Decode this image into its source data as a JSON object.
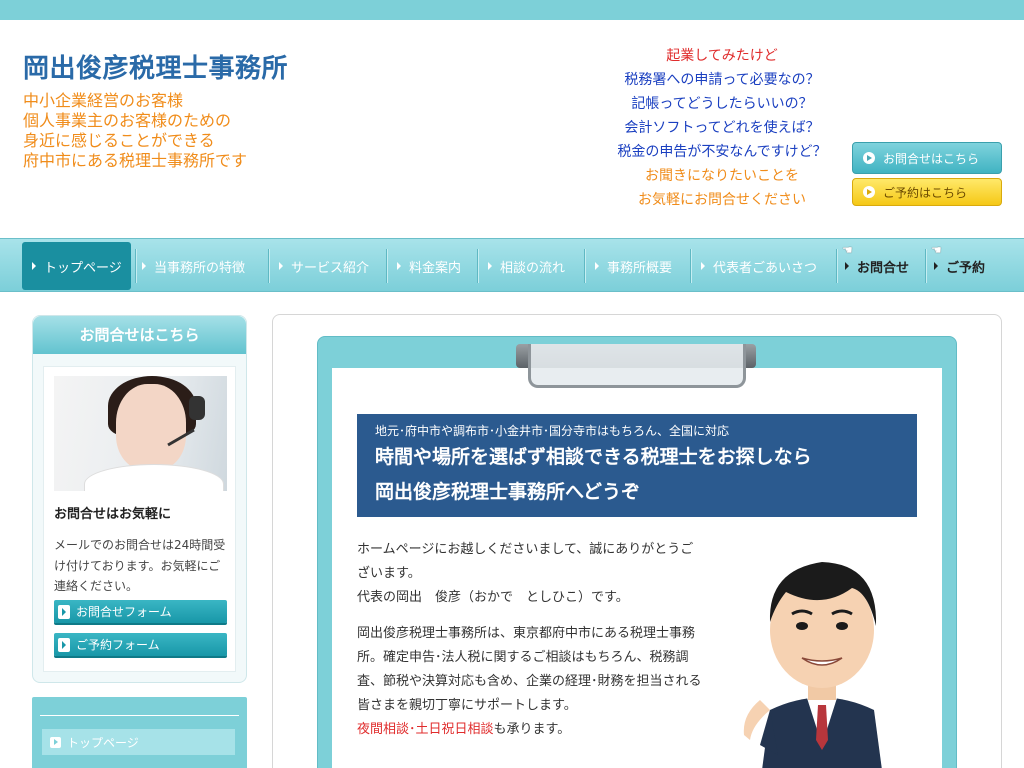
{
  "header": {
    "site_title": "岡出俊彦税理士事務所",
    "tagline": [
      "中小企業経営のお客様",
      "個人事業主のお客様のための",
      "身近に感じることができる",
      "府中市にある税理士事務所です"
    ],
    "faq": [
      {
        "text": "起業してみたけど",
        "color": "#e02c2c"
      },
      {
        "text": "税務署への申請って必要なの？",
        "color": "#1a3fc0"
      },
      {
        "text": "記帳ってどうしたらいいの？",
        "color": "#1a3fc0"
      },
      {
        "text": "会計ソフトってどれを使えば？",
        "color": "#1a3fc0"
      },
      {
        "text": "税金の申告が不安なんですけど？",
        "color": "#1a3fc0"
      },
      {
        "text": "お聞きになりたいことを",
        "color": "#f08c1a"
      },
      {
        "text": "お気軽にお問合せください",
        "color": "#f08c1a"
      }
    ],
    "contact_button": "お問合せはこちら",
    "reserve_button": "ご予約はこちら"
  },
  "nav": {
    "items": [
      "トップページ",
      "当事務所の特徴",
      "サービス紹介",
      "料金案内",
      "相談の流れ",
      "事務所概要",
      "代表者ごあいさつ",
      "お問合せ",
      "ご予約"
    ]
  },
  "sidebar": {
    "title": "お問合せはこちら",
    "heading": "お問合せはお気軽に",
    "text": "メールでのお問合せは24時間受け付けております。お気軽にご連絡ください。",
    "form_button": "お問合せフォーム",
    "reserve_form_button": "ご予約フォーム",
    "menu_item": "トップページ"
  },
  "main": {
    "banner_small": "地元･府中市や調布市･小金井市･国分寺市はもちろん、全国に対応",
    "banner_line1": "時間や場所を選ばず相談できる税理士をお探しなら",
    "banner_line2": "岡出俊彦税理士事務所へどうぞ",
    "para1": "ホームページにお越しくださいまして、誠にありがとうございます。",
    "para1b": "代表の岡出　俊彦（おかで　としひこ）です。",
    "para2": "岡出俊彦税理士事務所は、東京都府中市にある税理士事務所。確定申告･法人税に関するご相談はもちろん、税務調査、節税や決算対応も含め、企業の経理･財務を担当される皆さまを親切丁寧にサポートします。",
    "para2_red": "夜間相談･土日祝日相談",
    "para2_end": "も承ります。"
  }
}
